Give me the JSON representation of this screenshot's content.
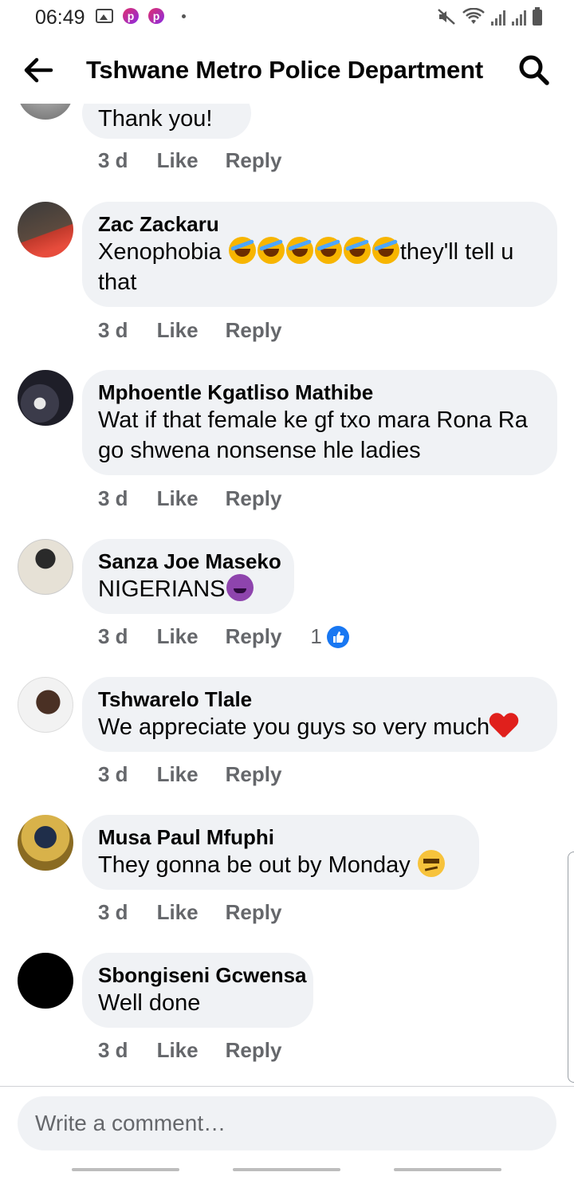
{
  "status_bar": {
    "time": "06:49"
  },
  "header": {
    "title": "Tshwane Metro Police Department"
  },
  "top_partial_comment": {
    "text": "Thank you!",
    "time": "3 d",
    "like": "Like",
    "reply": "Reply"
  },
  "comments": [
    {
      "author": "Zac Zackaru",
      "text_before": "Xenophobia ",
      "text_after": "they'll tell u that",
      "emoji": "rolling-on-floor-laughing x6",
      "time": "3 d",
      "like": "Like",
      "reply": "Reply"
    },
    {
      "author": "Mphoentle Kgatliso Mathibe",
      "text": "Wat if that female ke gf txo mara Rona Ra go shwena nonsense hle ladies",
      "time": "3 d",
      "like": "Like",
      "reply": "Reply"
    },
    {
      "author": "Sanza Joe Maseko",
      "text": "NIGERIANS",
      "emoji": "smiling-face-with-horns",
      "time": "3 d",
      "like": "Like",
      "reply": "Reply",
      "reaction_count": "1"
    },
    {
      "author": "Tshwarelo Tlale",
      "text": "We appreciate you guys so very much",
      "emoji": "red-heart",
      "time": "3 d",
      "like": "Like",
      "reply": "Reply"
    },
    {
      "author": "Musa Paul Mfuphi",
      "text": "They gonna be out by Monday ",
      "emoji": "smirking-face",
      "time": "3 d",
      "like": "Like",
      "reply": "Reply"
    },
    {
      "author": "Sbongiseni Gcwensa",
      "text": "Well done",
      "time": "3 d",
      "like": "Like",
      "reply": "Reply"
    }
  ],
  "composer": {
    "placeholder": "Write a comment…"
  }
}
